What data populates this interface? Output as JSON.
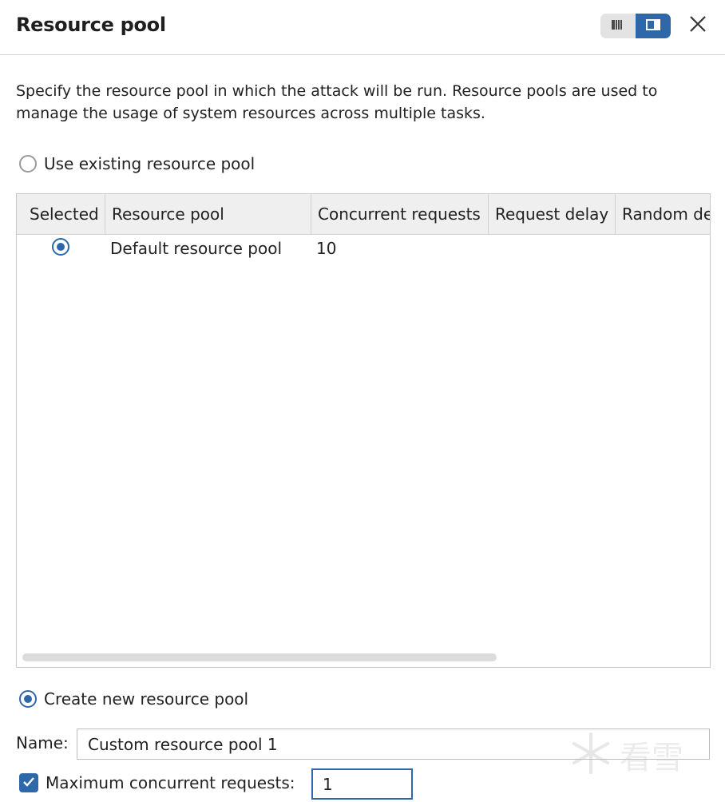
{
  "dialog": {
    "title": "Resource pool"
  },
  "header": {
    "view_toggle_left_icon": "list-view-icon",
    "view_toggle_right_icon": "panel-view-icon",
    "close_icon": "close-icon"
  },
  "description": "Specify the resource pool in which the attack will be run. Resource pools are used to manage the usage of system resources across multiple tasks.",
  "existing_option": {
    "label": "Use existing resource pool",
    "selected": false
  },
  "table": {
    "columns": [
      "Selected",
      "Resource pool",
      "Concurrent requests",
      "Request delay",
      "Random de"
    ],
    "rows": [
      {
        "selected": true,
        "resource_pool": "Default resource pool",
        "concurrent_requests": "10",
        "request_delay": "",
        "random_delay": ""
      }
    ]
  },
  "new_option": {
    "label": "Create new resource pool",
    "selected": true
  },
  "name_field": {
    "label": "Name:",
    "value": "Custom resource pool 1"
  },
  "max_concurrent": {
    "label": "Maximum concurrent requests:",
    "checked": true,
    "value": "1"
  },
  "watermark": {
    "text": "看雪"
  },
  "colors": {
    "accent": "#2f68a8",
    "header_bg": "#efefef",
    "border": "#c9c9c9"
  }
}
